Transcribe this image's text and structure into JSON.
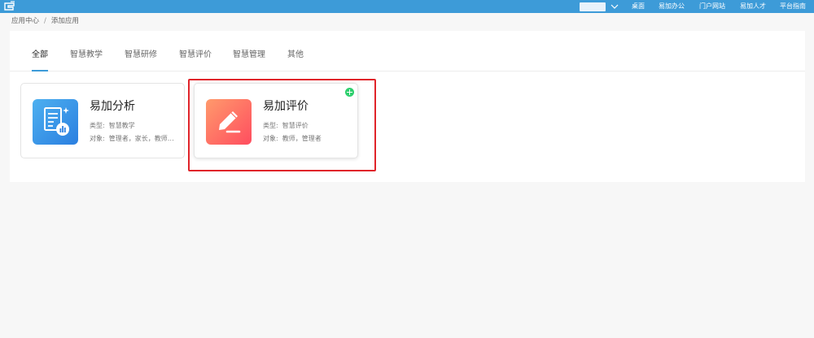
{
  "topbar": {
    "color": "#3d9bd8",
    "logo_icon": "app-logo-icon",
    "nav": [
      "桌面",
      "易加办公",
      "门户网站",
      "易加人才",
      "平台指南"
    ]
  },
  "breadcrumb": {
    "items": [
      "应用中心",
      "添加应用"
    ],
    "separator": "/"
  },
  "tabs": {
    "active": 0,
    "items": [
      "全部",
      "智慧教学",
      "智慧研修",
      "智慧评价",
      "智慧管理",
      "其他"
    ]
  },
  "cards": [
    {
      "title": "易加分析",
      "type_label": "类型:",
      "type_value": "智慧教学",
      "target_label": "对象:",
      "target_value": "管理者，家长，教师…",
      "icon": "analysis-report-icon"
    },
    {
      "title": "易加评价",
      "type_label": "类型:",
      "type_value": "智慧评价",
      "target_label": "对象:",
      "target_value": "教师，管理者",
      "icon": "pencil-edit-icon",
      "badge_icon": "add-circle-icon"
    }
  ],
  "colors": {
    "accent": "#3d9bd8",
    "highlight": "#e0242a",
    "add_badge": "#2fcf6e"
  }
}
